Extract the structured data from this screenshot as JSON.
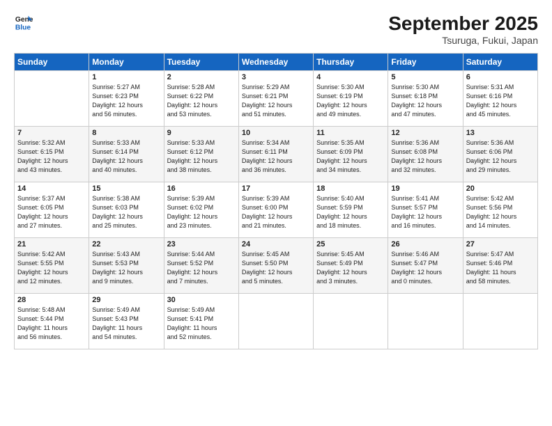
{
  "header": {
    "logo_line1": "General",
    "logo_line2": "Blue",
    "month": "September 2025",
    "location": "Tsuruga, Fukui, Japan"
  },
  "days_of_week": [
    "Sunday",
    "Monday",
    "Tuesday",
    "Wednesday",
    "Thursday",
    "Friday",
    "Saturday"
  ],
  "weeks": [
    [
      {
        "day": "",
        "text": ""
      },
      {
        "day": "1",
        "text": "Sunrise: 5:27 AM\nSunset: 6:23 PM\nDaylight: 12 hours\nand 56 minutes."
      },
      {
        "day": "2",
        "text": "Sunrise: 5:28 AM\nSunset: 6:22 PM\nDaylight: 12 hours\nand 53 minutes."
      },
      {
        "day": "3",
        "text": "Sunrise: 5:29 AM\nSunset: 6:21 PM\nDaylight: 12 hours\nand 51 minutes."
      },
      {
        "day": "4",
        "text": "Sunrise: 5:30 AM\nSunset: 6:19 PM\nDaylight: 12 hours\nand 49 minutes."
      },
      {
        "day": "5",
        "text": "Sunrise: 5:30 AM\nSunset: 6:18 PM\nDaylight: 12 hours\nand 47 minutes."
      },
      {
        "day": "6",
        "text": "Sunrise: 5:31 AM\nSunset: 6:16 PM\nDaylight: 12 hours\nand 45 minutes."
      }
    ],
    [
      {
        "day": "7",
        "text": "Sunrise: 5:32 AM\nSunset: 6:15 PM\nDaylight: 12 hours\nand 43 minutes."
      },
      {
        "day": "8",
        "text": "Sunrise: 5:33 AM\nSunset: 6:14 PM\nDaylight: 12 hours\nand 40 minutes."
      },
      {
        "day": "9",
        "text": "Sunrise: 5:33 AM\nSunset: 6:12 PM\nDaylight: 12 hours\nand 38 minutes."
      },
      {
        "day": "10",
        "text": "Sunrise: 5:34 AM\nSunset: 6:11 PM\nDaylight: 12 hours\nand 36 minutes."
      },
      {
        "day": "11",
        "text": "Sunrise: 5:35 AM\nSunset: 6:09 PM\nDaylight: 12 hours\nand 34 minutes."
      },
      {
        "day": "12",
        "text": "Sunrise: 5:36 AM\nSunset: 6:08 PM\nDaylight: 12 hours\nand 32 minutes."
      },
      {
        "day": "13",
        "text": "Sunrise: 5:36 AM\nSunset: 6:06 PM\nDaylight: 12 hours\nand 29 minutes."
      }
    ],
    [
      {
        "day": "14",
        "text": "Sunrise: 5:37 AM\nSunset: 6:05 PM\nDaylight: 12 hours\nand 27 minutes."
      },
      {
        "day": "15",
        "text": "Sunrise: 5:38 AM\nSunset: 6:03 PM\nDaylight: 12 hours\nand 25 minutes."
      },
      {
        "day": "16",
        "text": "Sunrise: 5:39 AM\nSunset: 6:02 PM\nDaylight: 12 hours\nand 23 minutes."
      },
      {
        "day": "17",
        "text": "Sunrise: 5:39 AM\nSunset: 6:00 PM\nDaylight: 12 hours\nand 21 minutes."
      },
      {
        "day": "18",
        "text": "Sunrise: 5:40 AM\nSunset: 5:59 PM\nDaylight: 12 hours\nand 18 minutes."
      },
      {
        "day": "19",
        "text": "Sunrise: 5:41 AM\nSunset: 5:57 PM\nDaylight: 12 hours\nand 16 minutes."
      },
      {
        "day": "20",
        "text": "Sunrise: 5:42 AM\nSunset: 5:56 PM\nDaylight: 12 hours\nand 14 minutes."
      }
    ],
    [
      {
        "day": "21",
        "text": "Sunrise: 5:42 AM\nSunset: 5:55 PM\nDaylight: 12 hours\nand 12 minutes."
      },
      {
        "day": "22",
        "text": "Sunrise: 5:43 AM\nSunset: 5:53 PM\nDaylight: 12 hours\nand 9 minutes."
      },
      {
        "day": "23",
        "text": "Sunrise: 5:44 AM\nSunset: 5:52 PM\nDaylight: 12 hours\nand 7 minutes."
      },
      {
        "day": "24",
        "text": "Sunrise: 5:45 AM\nSunset: 5:50 PM\nDaylight: 12 hours\nand 5 minutes."
      },
      {
        "day": "25",
        "text": "Sunrise: 5:45 AM\nSunset: 5:49 PM\nDaylight: 12 hours\nand 3 minutes."
      },
      {
        "day": "26",
        "text": "Sunrise: 5:46 AM\nSunset: 5:47 PM\nDaylight: 12 hours\nand 0 minutes."
      },
      {
        "day": "27",
        "text": "Sunrise: 5:47 AM\nSunset: 5:46 PM\nDaylight: 11 hours\nand 58 minutes."
      }
    ],
    [
      {
        "day": "28",
        "text": "Sunrise: 5:48 AM\nSunset: 5:44 PM\nDaylight: 11 hours\nand 56 minutes."
      },
      {
        "day": "29",
        "text": "Sunrise: 5:49 AM\nSunset: 5:43 PM\nDaylight: 11 hours\nand 54 minutes."
      },
      {
        "day": "30",
        "text": "Sunrise: 5:49 AM\nSunset: 5:41 PM\nDaylight: 11 hours\nand 52 minutes."
      },
      {
        "day": "",
        "text": ""
      },
      {
        "day": "",
        "text": ""
      },
      {
        "day": "",
        "text": ""
      },
      {
        "day": "",
        "text": ""
      }
    ]
  ]
}
